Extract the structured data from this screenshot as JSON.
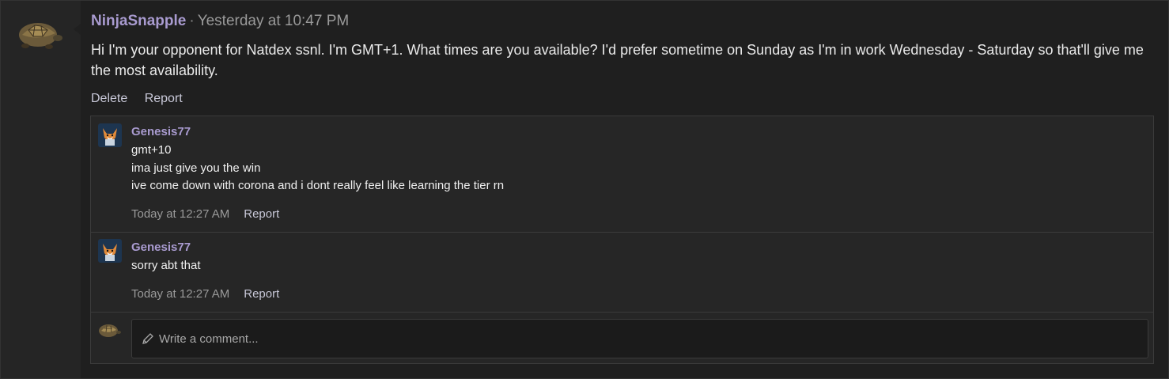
{
  "post": {
    "author": "NinjaSnapple",
    "separator": "·",
    "timestamp": "Yesterday at 10:47 PM",
    "body": "Hi I'm your opponent for Natdex ssnl. I'm GMT+1. What times are you available? I'd prefer sometime on Sunday as I'm in work Wednesday - Saturday so that'll give me the most availability.",
    "actions": {
      "delete": "Delete",
      "report": "Report"
    }
  },
  "comments": [
    {
      "author": "Genesis77",
      "lines": [
        "gmt+10",
        "ima just give you the win",
        "ive come down with corona and i dont really feel like learning the tier rn"
      ],
      "timestamp": "Today at 12:27 AM",
      "report": "Report"
    },
    {
      "author": "Genesis77",
      "lines": [
        "sorry abt that"
      ],
      "timestamp": "Today at 12:27 AM",
      "report": "Report"
    }
  ],
  "composer": {
    "placeholder": "Write a comment..."
  },
  "colors": {
    "accent_name": "#a99bd0",
    "background": "#1f1f1f",
    "panel": "#262626"
  },
  "icons": {
    "main_avatar": "turtle-avatar-icon",
    "comment_avatar": "fox-avatar-icon",
    "composer": "pencil-icon"
  }
}
